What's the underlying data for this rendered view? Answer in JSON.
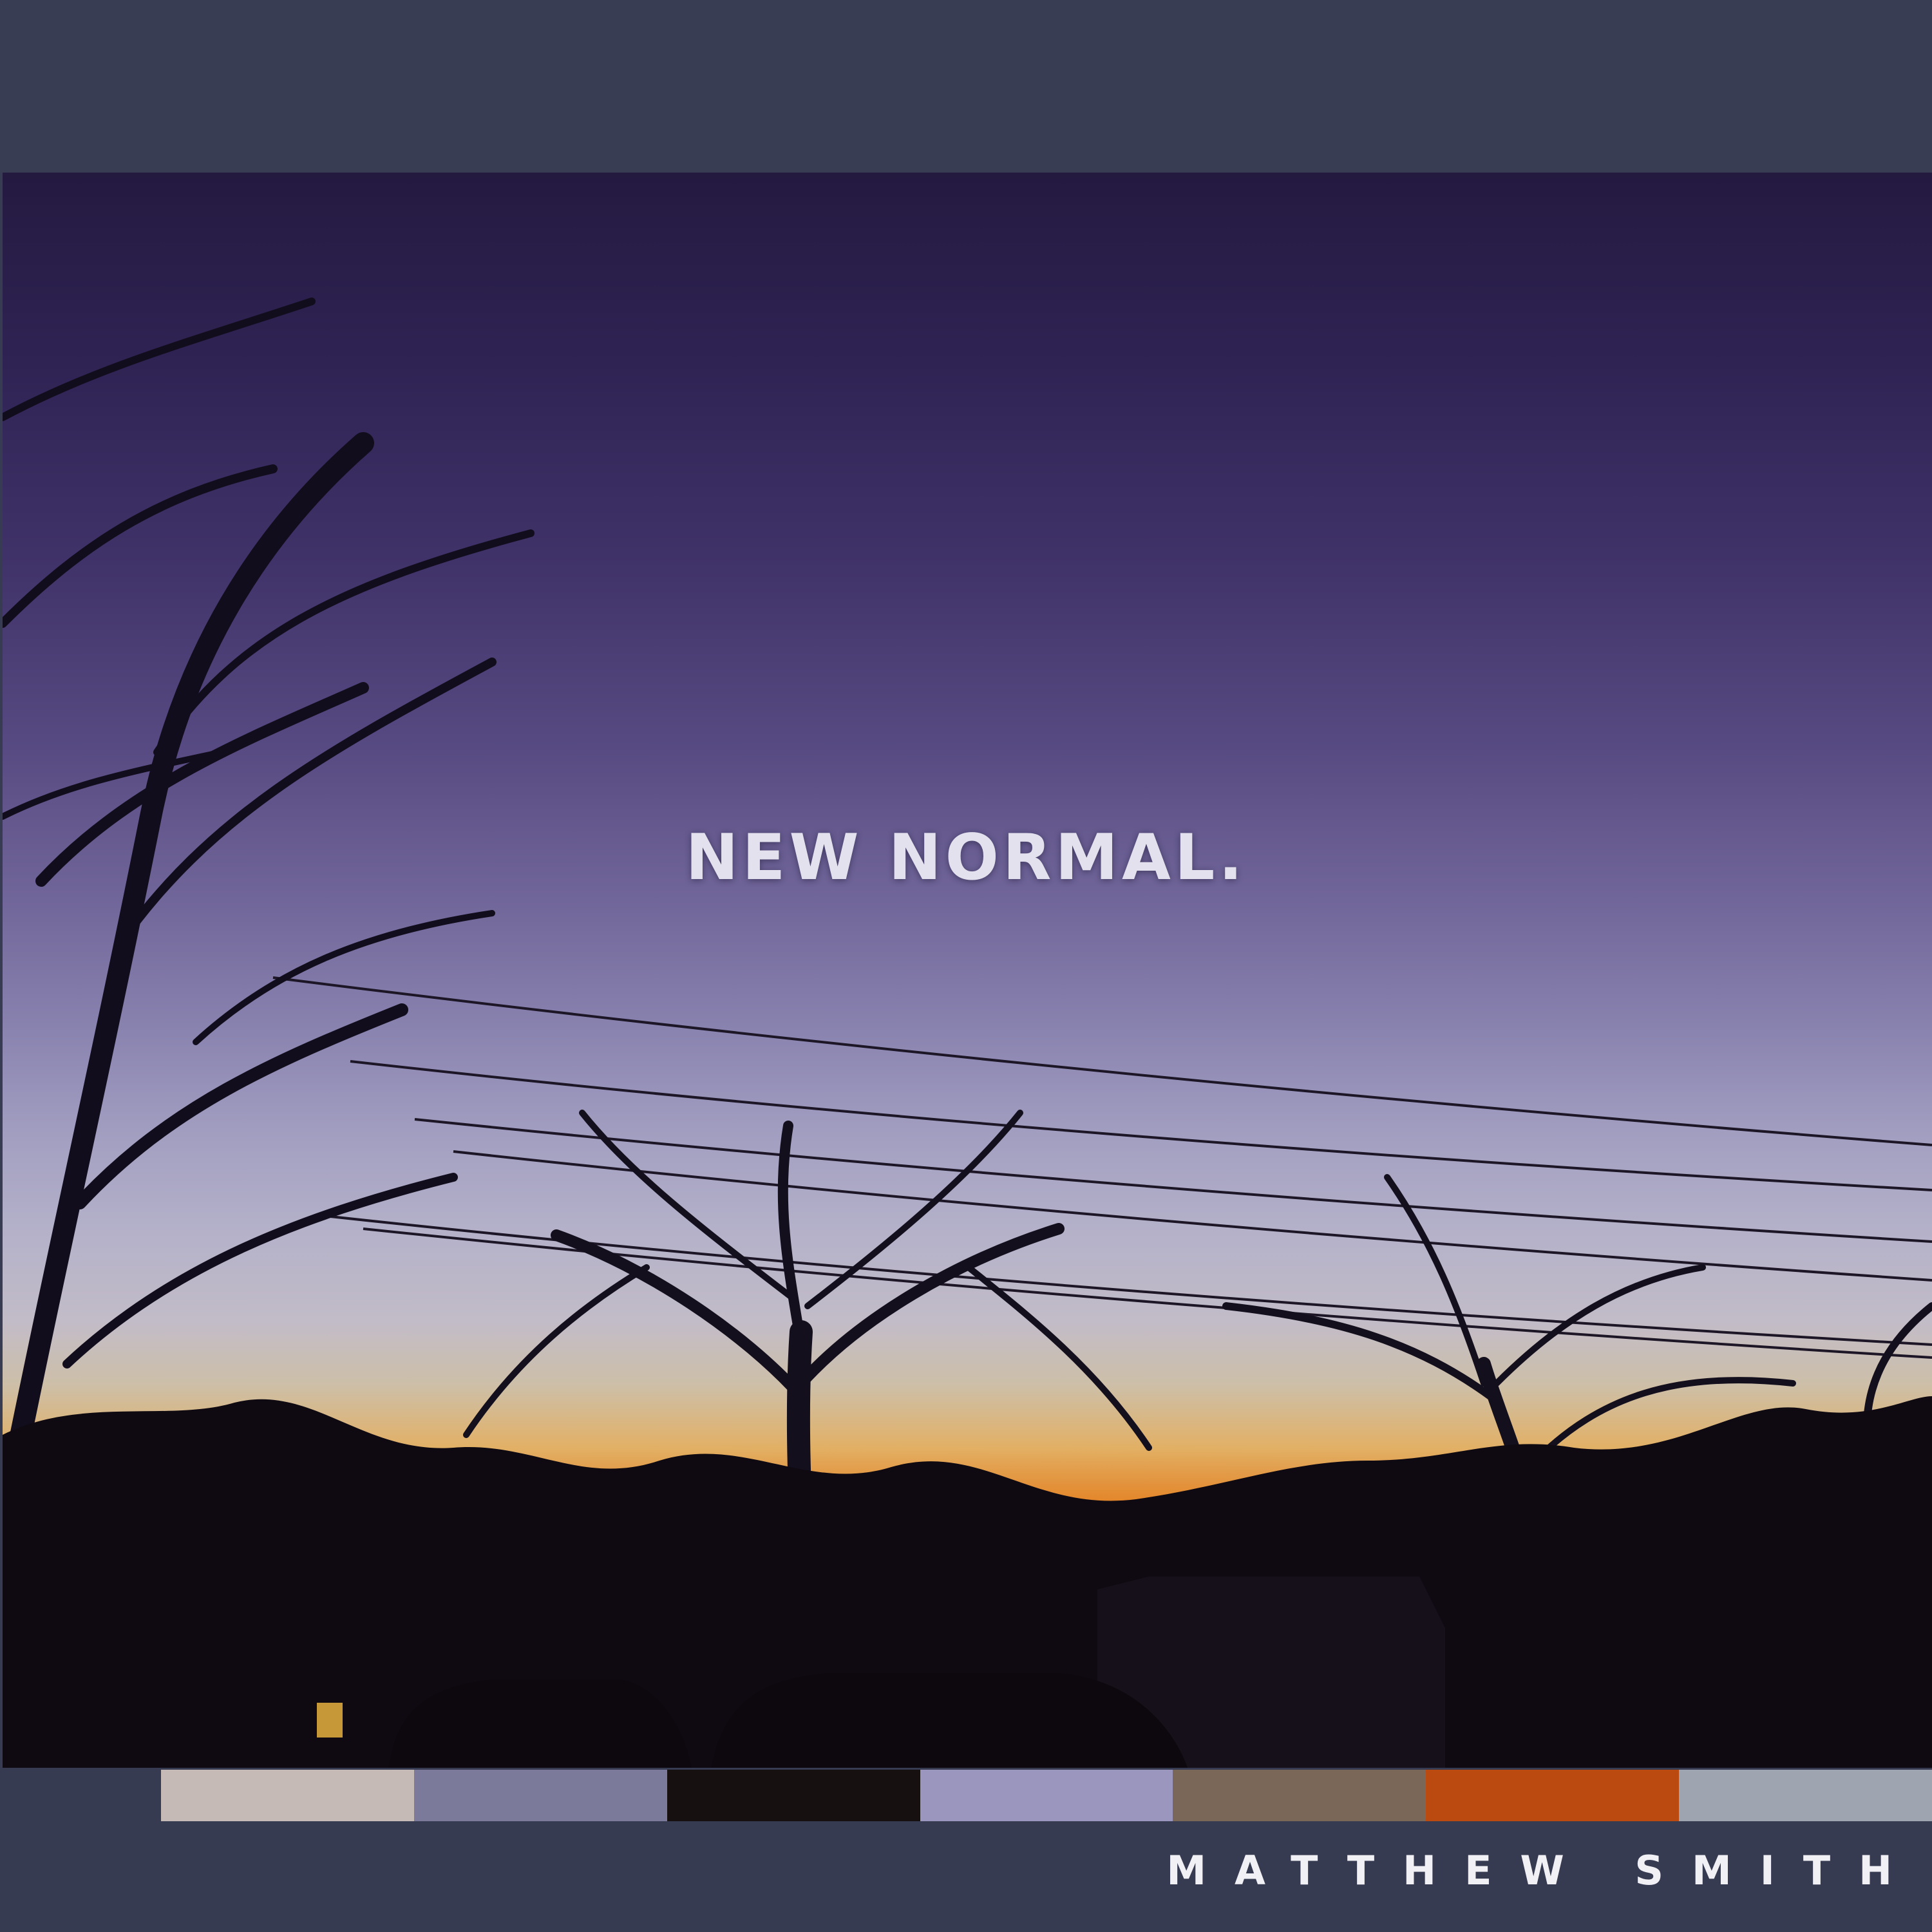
{
  "album": {
    "title": "NEW NORMAL.",
    "artist": "MATTHEW SMITH"
  },
  "palette": {
    "swatches": [
      {
        "color": "#c5bab5"
      },
      {
        "color": "#7c7a9a"
      },
      {
        "color": "#161010"
      },
      {
        "color": "#9b96bd"
      },
      {
        "color": "#7a6758"
      },
      {
        "color": "#bb4a10"
      },
      {
        "color": "#9fa4b1"
      }
    ]
  },
  "colors": {
    "band": "#383c52",
    "title_text": "#e4e1ee",
    "artist_text": "#f1f0f4"
  }
}
